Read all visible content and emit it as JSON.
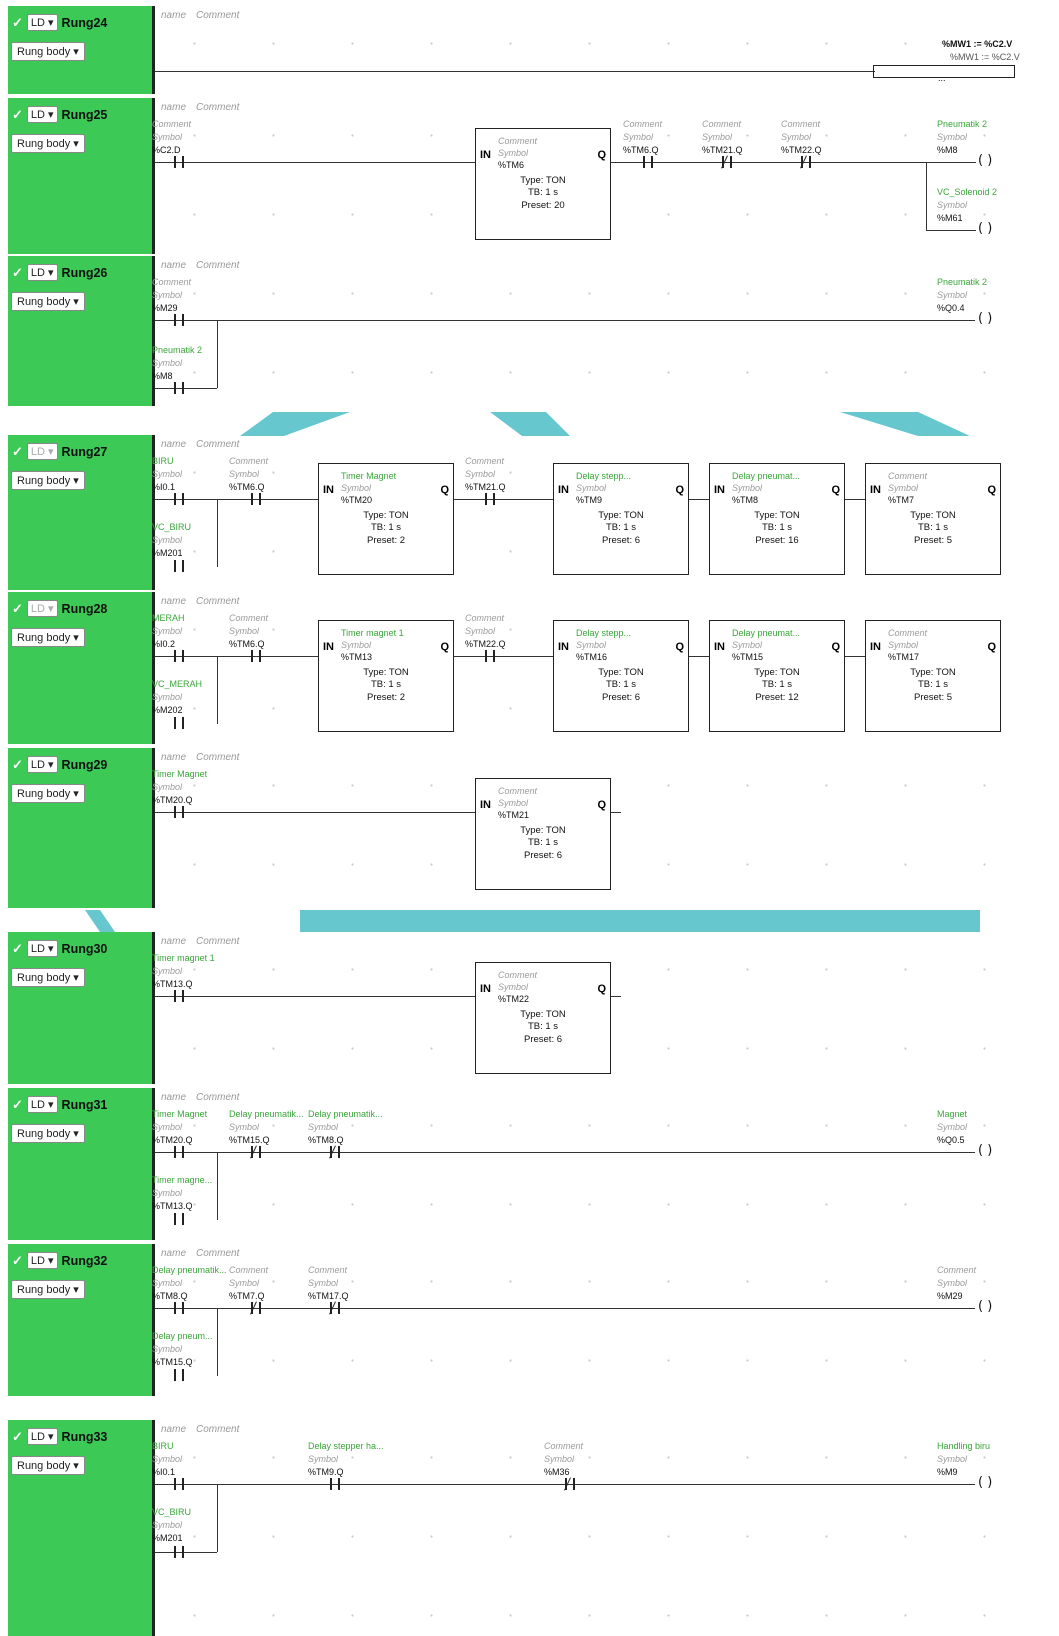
{
  "labels": {
    "ld": "LD",
    "rung_body": "Rung body",
    "name": "name",
    "comment": "Comment",
    "symbol": "Symbol",
    "in": "IN",
    "q": "Q",
    "type": "Type: TON",
    "tb": "TB: 1 s",
    "preset": "Preset: "
  },
  "rung24": {
    "name": "Rung24",
    "assign_top": "%MW1 := %C2.V",
    "assign_sub": "%MW1 := %C2.V",
    "ellipsis": "..."
  },
  "rung25": {
    "name": "Rung25",
    "c1": "%C2.D",
    "fb_addr": "%TM6",
    "preset": "Preset: 20",
    "c2": "%TM6.Q",
    "c3": "%TM21.Q",
    "c4": "%TM22.Q",
    "coil1_name": "Pneumatik 2",
    "coil1": "%M8",
    "coil2_name": "VC_Solenoid 2",
    "coil2": "%M61"
  },
  "rung26": {
    "name": "Rung26",
    "c1": "%M29",
    "c2_name": "Pneumatik 2",
    "c2": "%M8",
    "coil_name": "Pneumatik 2",
    "coil": "%Q0.4"
  },
  "rung27": {
    "name": "Rung27",
    "c1_name": "BIRU",
    "c1": "%I0.1",
    "c2_name": "VC_BIRU",
    "c2": "%M201",
    "c3": "%TM6.Q",
    "fb1_name": "Timer Magnet",
    "fb1": "%TM20",
    "fb1_preset": "Preset: 2",
    "c4": "%TM21.Q",
    "fb2_name": "Delay stepp...",
    "fb2": "%TM9",
    "fb2_preset": "Preset: 6",
    "fb3_name": "Delay pneumat...",
    "fb3": "%TM8",
    "fb3_preset": "Preset: 16",
    "fb4": "%TM7",
    "fb4_preset": "Preset: 5"
  },
  "rung28": {
    "name": "Rung28",
    "c1_name": "MERAH",
    "c1": "%I0.2",
    "c2_name": "VC_MERAH",
    "c2": "%M202",
    "c3": "%TM6.Q",
    "fb1_name": "Timer magnet 1",
    "fb1": "%TM13",
    "fb1_preset": "Preset: 2",
    "c4": "%TM22.Q",
    "fb2_name": "Delay stepp...",
    "fb2": "%TM16",
    "fb2_preset": "Preset: 6",
    "fb3_name": "Delay pneumat...",
    "fb3": "%TM15",
    "fb3_preset": "Preset: 12",
    "fb4": "%TM17",
    "fb4_preset": "Preset: 5"
  },
  "rung29": {
    "name": "Rung29",
    "c1_name": "Timer Magnet",
    "c1": "%TM20.Q",
    "fb": "%TM21",
    "preset": "Preset: 6"
  },
  "rung30": {
    "name": "Rung30",
    "c1_name": "Timer magnet 1",
    "c1": "%TM13.Q",
    "fb": "%TM22",
    "preset": "Preset: 6"
  },
  "rung31": {
    "name": "Rung31",
    "c1_name": "Timer Magnet",
    "c1": "%TM20.Q",
    "c2_name": "Timer magne...",
    "c2": "%TM13.Q",
    "c3_name": "Delay pneumatik...",
    "c3": "%TM15.Q",
    "c4_name": "Delay pneumatik...",
    "c4": "%TM8.Q",
    "coil_name": "Magnet",
    "coil": "%Q0.5"
  },
  "rung32": {
    "name": "Rung32",
    "c1_name": "Delay pneumatik...",
    "c1": "%TM8.Q",
    "c2_name": "Delay pneum...",
    "c2": "%TM15.Q",
    "c3": "%TM7.Q",
    "c4": "%TM17.Q",
    "coil": "%M29"
  },
  "rung33": {
    "name": "Rung33",
    "c1_name": "BIRU",
    "c1": "%I0.1",
    "c2_name": "VC_BIRU",
    "c2": "%M201",
    "c3_name": "Delay stepper ha...",
    "c3": "%TM9.Q",
    "c4": "%M36",
    "coil_name": "Handling biru",
    "coil": "%M9"
  },
  "colors": {
    "rung_side": "#3cc956",
    "label_green": "#3aa63a",
    "decor": "#66c7cf"
  }
}
